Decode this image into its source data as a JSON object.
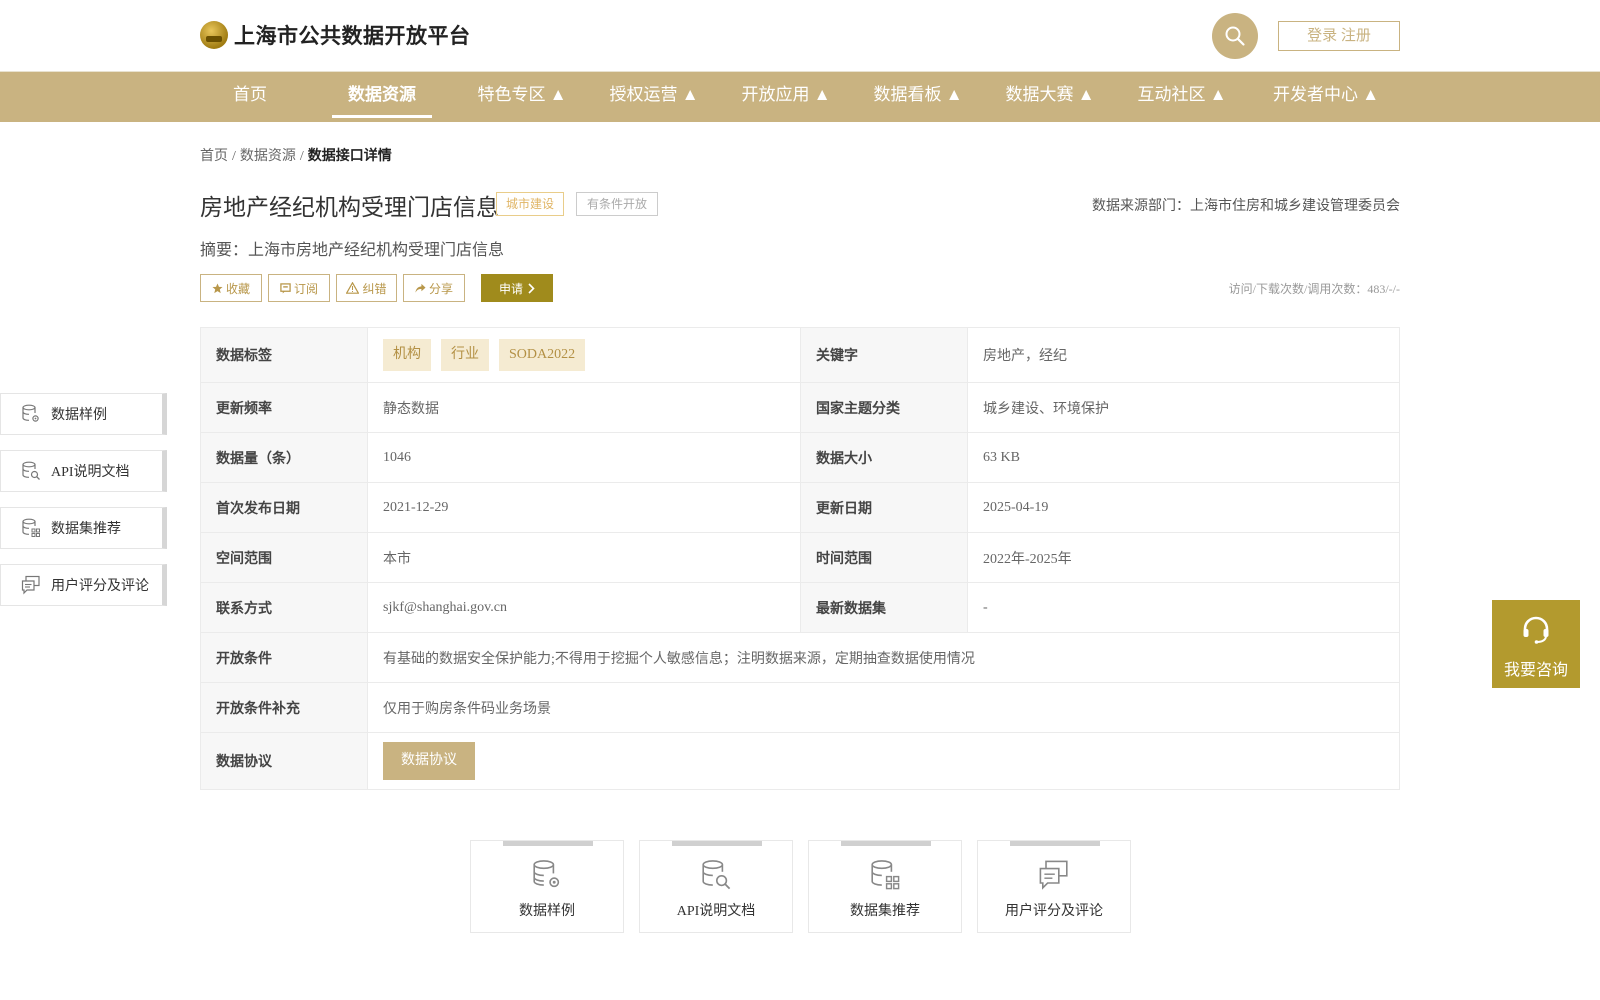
{
  "header": {
    "site_title": "上海市公共数据开放平台",
    "login_label": "登录 注册"
  },
  "nav": {
    "items": [
      {
        "label": "首页"
      },
      {
        "label": "数据资源"
      },
      {
        "label": "特色专区 ▲"
      },
      {
        "label": "授权运营 ▲"
      },
      {
        "label": "开放应用 ▲"
      },
      {
        "label": "数据看板 ▲"
      },
      {
        "label": "数据大赛 ▲"
      },
      {
        "label": "互动社区 ▲"
      },
      {
        "label": "开发者中心 ▲"
      }
    ],
    "active_index": 1
  },
  "breadcrumb": {
    "home": "首页",
    "sep": "/",
    "section": "数据资源",
    "current": "数据接口详情"
  },
  "detail": {
    "title": "房地产经纪机构受理门店信息",
    "tag_category": "城市建设",
    "tag_open": "有条件开放",
    "source": "数据来源部门：上海市住房和城乡建设管理委员会",
    "summary": "摘要：上海市房地产经纪机构受理门店信息",
    "stats": "访问/下载次数/调用次数：483/-/-"
  },
  "actions": {
    "favorite": "收藏",
    "subscribe": "订阅",
    "report": "纠错",
    "share": "分享",
    "apply": "申请"
  },
  "table": {
    "tags_label": "数据标签",
    "tags": [
      "机构",
      "行业",
      "SODA2022"
    ],
    "keywords_label": "关键字",
    "keywords": "房地产，经纪",
    "freq_label": "更新频率",
    "freq": "静态数据",
    "theme_label": "国家主题分类",
    "theme": "城乡建设、环境保护",
    "count_label": "数据量（条）",
    "count": "1046",
    "size_label": "数据大小",
    "size": "63 KB",
    "first_pub_label": "首次发布日期",
    "first_pub": "2021-12-29",
    "updated_label": "更新日期",
    "updated": "2025-04-19",
    "space_label": "空间范围",
    "space": "本市",
    "time_label": "时间范围",
    "time": "2022年-2025年",
    "contact_label": "联系方式",
    "contact": "sjkf@shanghai.gov.cn",
    "latest_label": "最新数据集",
    "latest": "-",
    "cond_label": "开放条件",
    "cond": "有基础的数据安全保护能力;不得用于挖掘个人敏感信息；注明数据来源，定期抽查数据使用情况",
    "cond_extra_label": "开放条件补充",
    "cond_extra": "仅用于购房条件码业务场景",
    "agreement_label": "数据协议",
    "agreement_button": "数据协议"
  },
  "side_nav": [
    {
      "label": "数据样例",
      "icon": "database-gear-icon"
    },
    {
      "label": "API说明文档",
      "icon": "database-search-icon"
    },
    {
      "label": "数据集推荐",
      "icon": "database-grid-icon"
    },
    {
      "label": "用户评分及评论",
      "icon": "comment-icon"
    }
  ],
  "cards": [
    {
      "label": "数据样例",
      "icon": "database-gear-icon"
    },
    {
      "label": "API说明文档",
      "icon": "database-search-icon"
    },
    {
      "label": "数据集推荐",
      "icon": "database-grid-icon"
    },
    {
      "label": "用户评分及评论",
      "icon": "comment-icon"
    }
  ],
  "consult": {
    "label": "我要咨询",
    "icon": "headset-icon"
  },
  "colors": {
    "brand": "#c9b381",
    "apply": "#a08b1c",
    "consult": "#b39a2e"
  }
}
